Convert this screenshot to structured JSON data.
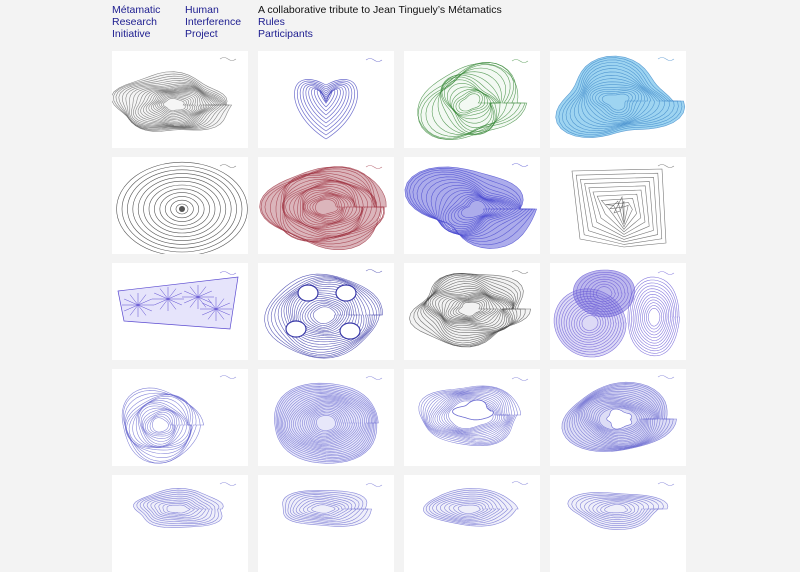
{
  "nav": {
    "site": [
      "Métamatic",
      "Research",
      "Initiative"
    ],
    "project": [
      "Human",
      "Interference",
      "Project"
    ],
    "tagline": "A collaborative tribute to Jean Tinguely’s Métamatics",
    "links": [
      "Rules",
      "Participants"
    ]
  },
  "drawings": [
    {
      "color": "#6a6a6a",
      "style": "blob-filled"
    },
    {
      "color": "#4b4bc0",
      "style": "heart-open"
    },
    {
      "color": "#3a8a3a",
      "style": "flower"
    },
    {
      "color": "#3f88c9",
      "style": "cloud-blue"
    },
    {
      "color": "#555555",
      "style": "concentric"
    },
    {
      "color": "#a33b48",
      "style": "scribble-dense"
    },
    {
      "color": "#4a4ad0",
      "style": "star"
    },
    {
      "color": "#555555",
      "style": "maze"
    },
    {
      "color": "#5a4ad0",
      "style": "fans"
    },
    {
      "color": "#3a3aa8",
      "style": "swirl-holes"
    },
    {
      "color": "#555555",
      "style": "cloud-grey"
    },
    {
      "color": "#6a5ad6",
      "style": "overlap-ovals"
    },
    {
      "color": "#6a6ad0",
      "style": "disc-swirl"
    },
    {
      "color": "#6a6ad0",
      "style": "round-dense"
    },
    {
      "color": "#6a6ad0",
      "style": "ring-hole"
    },
    {
      "color": "#6a6ad0",
      "style": "ring-dense"
    },
    {
      "color": "#6a6ad0",
      "style": "partial"
    },
    {
      "color": "#6a6ad0",
      "style": "partial"
    },
    {
      "color": "#6a6ad0",
      "style": "partial"
    },
    {
      "color": "#6a6ad0",
      "style": "partial"
    }
  ]
}
